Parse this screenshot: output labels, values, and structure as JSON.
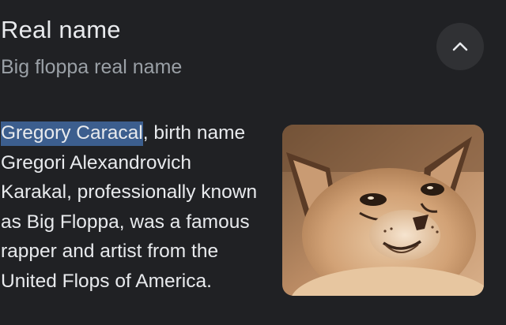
{
  "header": {
    "title": "Real name",
    "subtitle": "Big floppa real name"
  },
  "collapse_button": {
    "icon": "chevron-up-icon"
  },
  "answer": {
    "highlighted_term": "Gregory Caracal",
    "body": ", birth name Gregori Alexandrovich Karakal, professionally known as Big Floppa, was a famous rapper and artist from the United Flops of America."
  },
  "image": {
    "subject": "caracal cat photo"
  },
  "colors": {
    "background": "#202124",
    "primary_text": "#e8eaed",
    "secondary_text": "#9aa0a6",
    "highlight": "#3c5e8e",
    "button_bg": "#303134"
  }
}
